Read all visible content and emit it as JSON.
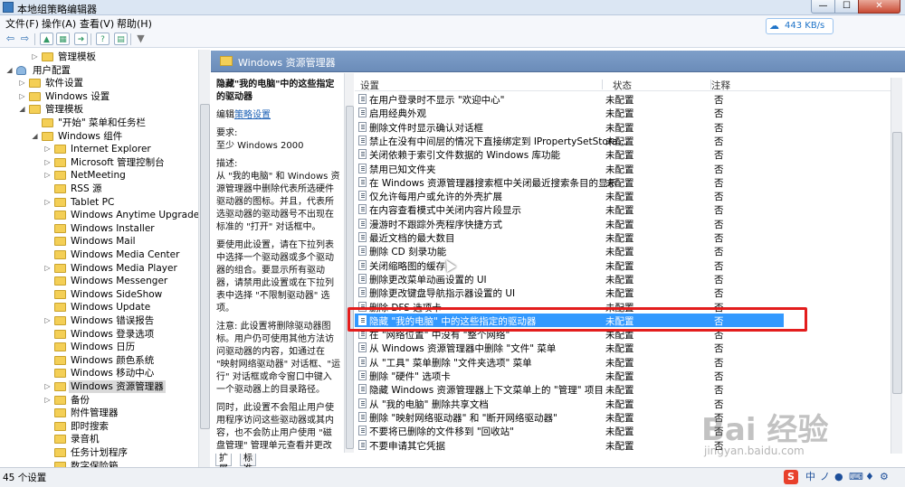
{
  "window": {
    "title": "本地组策略编辑器",
    "min_label": "—",
    "max_label": "☐",
    "close_label": "✕"
  },
  "menu": [
    "文件(F)",
    "操作(A)",
    "查看(V)",
    "帮助(H)"
  ],
  "speed": {
    "value": "443 KB/s"
  },
  "tree": {
    "items": [
      {
        "label": "管理模板",
        "level": 2,
        "expander": "▷",
        "icon": "folder"
      },
      {
        "label": "用户配置",
        "level": 0,
        "expander": "◢",
        "icon": "user"
      },
      {
        "label": "软件设置",
        "level": 1,
        "expander": "▷",
        "icon": "folder"
      },
      {
        "label": "Windows 设置",
        "level": 1,
        "expander": "▷",
        "icon": "folder"
      },
      {
        "label": "管理模板",
        "level": 1,
        "expander": "◢",
        "icon": "folder"
      },
      {
        "label": "\"开始\" 菜单和任务栏",
        "level": 2,
        "expander": "",
        "icon": "folder"
      },
      {
        "label": "Windows 组件",
        "level": 2,
        "expander": "◢",
        "icon": "folder"
      },
      {
        "label": "Internet Explorer",
        "level": 3,
        "expander": "▷",
        "icon": "folder"
      },
      {
        "label": "Microsoft 管理控制台",
        "level": 3,
        "expander": "▷",
        "icon": "folder"
      },
      {
        "label": "NetMeeting",
        "level": 3,
        "expander": "▷",
        "icon": "folder"
      },
      {
        "label": "RSS 源",
        "level": 3,
        "expander": "",
        "icon": "folder"
      },
      {
        "label": "Tablet PC",
        "level": 3,
        "expander": "▷",
        "icon": "folder"
      },
      {
        "label": "Windows Anytime Upgrade",
        "level": 3,
        "expander": "",
        "icon": "folder"
      },
      {
        "label": "Windows Installer",
        "level": 3,
        "expander": "",
        "icon": "folder"
      },
      {
        "label": "Windows Mail",
        "level": 3,
        "expander": "",
        "icon": "folder"
      },
      {
        "label": "Windows Media Center",
        "level": 3,
        "expander": "",
        "icon": "folder"
      },
      {
        "label": "Windows Media Player",
        "level": 3,
        "expander": "▷",
        "icon": "folder"
      },
      {
        "label": "Windows Messenger",
        "level": 3,
        "expander": "",
        "icon": "folder"
      },
      {
        "label": "Windows SideShow",
        "level": 3,
        "expander": "",
        "icon": "folder"
      },
      {
        "label": "Windows Update",
        "level": 3,
        "expander": "",
        "icon": "folder"
      },
      {
        "label": "Windows 错误报告",
        "level": 3,
        "expander": "▷",
        "icon": "folder"
      },
      {
        "label": "Windows 登录选项",
        "level": 3,
        "expander": "",
        "icon": "folder"
      },
      {
        "label": "Windows 日历",
        "level": 3,
        "expander": "",
        "icon": "folder"
      },
      {
        "label": "Windows 颜色系统",
        "level": 3,
        "expander": "",
        "icon": "folder"
      },
      {
        "label": "Windows 移动中心",
        "level": 3,
        "expander": "",
        "icon": "folder"
      },
      {
        "label": "Windows 资源管理器",
        "level": 3,
        "expander": "▷",
        "icon": "folder",
        "selected": true
      },
      {
        "label": "备份",
        "level": 3,
        "expander": "▷",
        "icon": "folder"
      },
      {
        "label": "附件管理器",
        "level": 3,
        "expander": "",
        "icon": "folder"
      },
      {
        "label": "即时搜索",
        "level": 3,
        "expander": "",
        "icon": "folder"
      },
      {
        "label": "录音机",
        "level": 3,
        "expander": "",
        "icon": "folder"
      },
      {
        "label": "任务计划程序",
        "level": 3,
        "expander": "",
        "icon": "folder"
      },
      {
        "label": "数字保险箱",
        "level": 3,
        "expander": "",
        "icon": "folder"
      }
    ]
  },
  "header": {
    "title": "Windows 资源管理器"
  },
  "description": {
    "title": "隐藏\"我的电脑\"中的这些指定的驱动器",
    "edit_prefix": "编辑",
    "edit_link": "策略设置",
    "requires_label": "要求:",
    "requires_value": "至少 Windows 2000",
    "desc_label": "描述:",
    "desc_text": "从 \"我的电脑\" 和 Windows 资源管理器中删除代表所选硬件驱动器的图标。并且，代表所选驱动器的驱动器号不出现在标准的 \"打开\" 对话框中。",
    "usage_text": "要使用此设置，请在下拉列表中选择一个驱动器或多个驱动器的组合。要显示所有驱动器，请禁用此设置或在下拉列表中选择 \"不限制驱动器\" 选项。",
    "note_text": "注意: 此设置将删除驱动器图标。用户仍可使用其他方法访问驱动器的内容，如通过在 \"映射网络驱动器\" 对话框、\"运行\" 对话框或命令窗口中键入一个驱动器上的目录路径。",
    "extra_text": "同时，此设置不会阻止用户使用程序访问这些驱动器或其内容，也不会防止用户使用 \"磁盘管理\" 管理单元查看并更改驱动器特性。"
  },
  "grid": {
    "columns": [
      "设置",
      "状态",
      "注释"
    ],
    "rows": [
      {
        "name": "在用户登录时不显示 \"欢迎中心\"",
        "state": "未配置",
        "note": "否"
      },
      {
        "name": "启用经典外观",
        "state": "未配置",
        "note": "否"
      },
      {
        "name": "删除文件时显示确认对话框",
        "state": "未配置",
        "note": "否"
      },
      {
        "name": "禁止在没有中间层的情况下直接绑定到 IPropertySetStora...",
        "state": "未配置",
        "note": "否"
      },
      {
        "name": "关闭依赖于索引文件数据的 Windows 库功能",
        "state": "未配置",
        "note": "否"
      },
      {
        "name": "禁用已知文件夹",
        "state": "未配置",
        "note": "否"
      },
      {
        "name": "在 Windows 资源管理器搜索框中关闭最近搜索条目的显示",
        "state": "未配置",
        "note": "否"
      },
      {
        "name": "仅允许每用户或允许的外壳扩展",
        "state": "未配置",
        "note": "否"
      },
      {
        "name": "在内容查看模式中关闭内容片段显示",
        "state": "未配置",
        "note": "否"
      },
      {
        "name": "漫游时不跟踪外壳程序快捷方式",
        "state": "未配置",
        "note": "否"
      },
      {
        "name": "最近文档的最大数目",
        "state": "未配置",
        "note": "否"
      },
      {
        "name": "删除 CD 刻录功能",
        "state": "未配置",
        "note": "否"
      },
      {
        "name": "关闭缩略图的缓存",
        "state": "未配置",
        "note": "否"
      },
      {
        "name": "删除更改菜单动画设置的 UI",
        "state": "未配置",
        "note": "否"
      },
      {
        "name": "删除更改键盘导航指示器设置的 UI",
        "state": "未配置",
        "note": "否"
      },
      {
        "name": "删除 DFS 选项卡",
        "state": "未配置",
        "note": "否"
      },
      {
        "name": "隐藏 \"我的电脑\" 中的这些指定的驱动器",
        "state": "未配置",
        "note": "否",
        "selected": true
      },
      {
        "name": "在 \"网络位置\" 中没有 \"整个网络\"",
        "state": "未配置",
        "note": "否"
      },
      {
        "name": "从 Windows 资源管理器中删除 \"文件\" 菜单",
        "state": "未配置",
        "note": "否"
      },
      {
        "name": "从 \"工具\" 菜单删除 \"文件夹选项\" 菜单",
        "state": "未配置",
        "note": "否"
      },
      {
        "name": "删除 \"硬件\" 选项卡",
        "state": "未配置",
        "note": "否"
      },
      {
        "name": "隐藏 Windows 资源管理器上下文菜单上的 \"管理\" 项目",
        "state": "未配置",
        "note": "否"
      },
      {
        "name": "从 \"我的电脑\" 删除共享文档",
        "state": "未配置",
        "note": "否"
      },
      {
        "name": "删除 \"映射网络驱动器\" 和 \"断开网络驱动器\"",
        "state": "未配置",
        "note": "否"
      },
      {
        "name": "不要将已删除的文件移到 \"回收站\"",
        "state": "未配置",
        "note": "否"
      },
      {
        "name": "不要申请其它凭据",
        "state": "未配置",
        "note": "否"
      }
    ]
  },
  "tabs": [
    "扩展",
    "标准"
  ],
  "status": {
    "text": "45 个设置"
  },
  "ime": {
    "s": "S",
    "labels": [
      "中",
      "ノ",
      "●",
      "⌨",
      "♦",
      "⚙"
    ]
  },
  "watermark": {
    "logo": "Bai 经验",
    "url": "jingyan.baidu.com"
  }
}
